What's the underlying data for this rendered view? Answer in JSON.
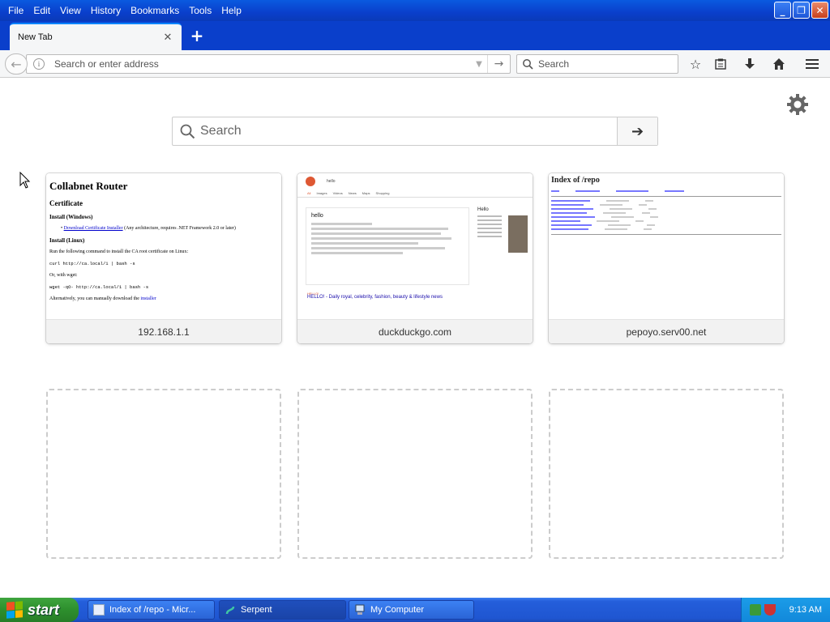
{
  "menu": [
    "File",
    "Edit",
    "View",
    "History",
    "Bookmarks",
    "Tools",
    "Help"
  ],
  "tab": {
    "title": "New Tab"
  },
  "navbar": {
    "url_placeholder": "Search or enter address",
    "search_placeholder": "Search"
  },
  "newtab": {
    "search_placeholder": "Search",
    "tiles": [
      {
        "label": "192.168.1.1"
      },
      {
        "label": "duckduckgo.com"
      },
      {
        "label": "pepoyo.serv00.net"
      }
    ]
  },
  "thumb1": {
    "title": "Collabnet Router",
    "h2": "Certificate",
    "win": "Install (Windows)",
    "win_link": "Download Certificate Installer",
    "win_rest": " (Any architecture, requires .NET Framework 2.0 or later)",
    "linux": "Install (Linux)",
    "linux_text": "Run the following command to install the CA root certificate on Linux:",
    "cmd1": "curl http://ca.local/1 | bash -s",
    "or_wget": "Or, with wget:",
    "cmd2": "wget -qO- http://ca.local/1 | bash -s",
    "alt_text": "Alternatively, you can manually download the ",
    "alt_link": "installer"
  },
  "thumb2": {
    "query": "hello",
    "tabs": [
      "All",
      "Images",
      "Videos",
      "News",
      "Maps",
      "Shopping"
    ],
    "word": "hello",
    "side_word": "Hello",
    "result": "HELLO! - Daily royal, celebrity, fashion, beauty & lifestyle news",
    "result_site": "HELLO!"
  },
  "thumb3": {
    "title": "Index of /repo"
  },
  "taskbar": {
    "start": "start",
    "tasks": [
      "Index of /repo - Micr...",
      "Serpent",
      "My Computer"
    ],
    "clock": "9:13 AM"
  },
  "colors": {
    "xp_blue": "#0a3fcb",
    "start_green": "#2d8f2d",
    "tab_accent": "#0a84ff"
  }
}
